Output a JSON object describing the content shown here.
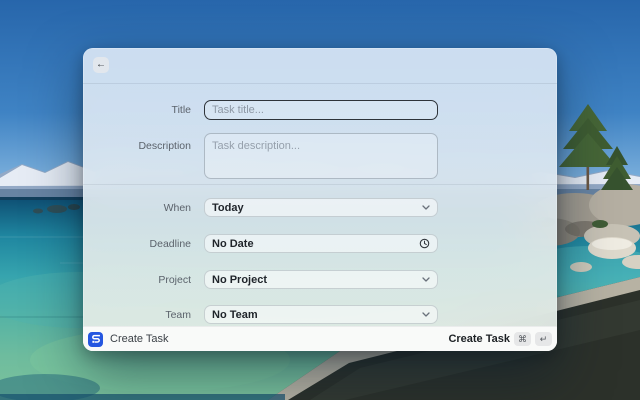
{
  "window": {
    "header": {
      "back_icon": "←"
    },
    "form": {
      "title": {
        "label": "Title",
        "placeholder": "Task title..."
      },
      "description": {
        "label": "Description",
        "placeholder": "Task description..."
      },
      "when": {
        "label": "When",
        "value": "Today"
      },
      "deadline": {
        "label": "Deadline",
        "value": "No Date"
      },
      "project": {
        "label": "Project",
        "value": "No Project"
      },
      "team": {
        "label": "Team",
        "value": "No Team"
      }
    },
    "footer": {
      "app_label": "Create Task",
      "submit_label": "Create Task",
      "keys": {
        "command": "⌘",
        "return": "↵"
      }
    }
  },
  "icons": {
    "back": "back-arrow-icon",
    "chevron": "chevron-down-icon",
    "clock": "clock-icon",
    "app": "app-logo-icon"
  },
  "colors": {
    "app_icon_blue": "#2456e0",
    "focus_border": "#2f343a",
    "sky_blue": "#2b6db4",
    "water_teal": "#2f9fae",
    "footer_bg": "#fbfbfb"
  }
}
